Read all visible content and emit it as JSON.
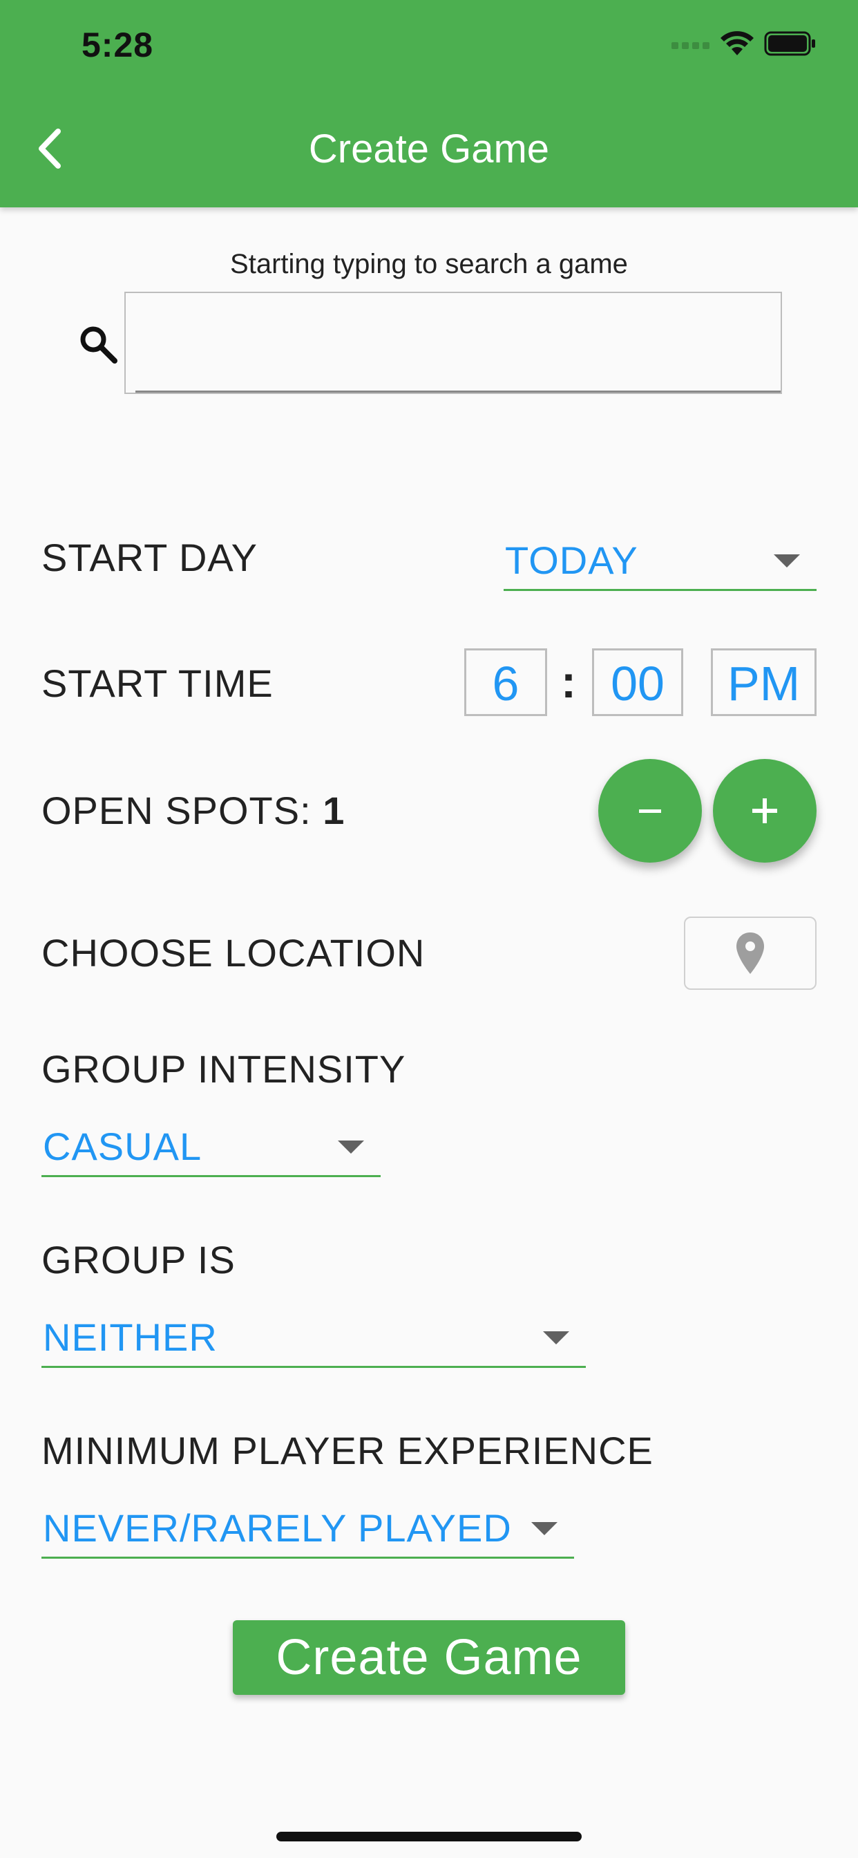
{
  "status_bar": {
    "time": "5:28"
  },
  "app_bar": {
    "title": "Create Game",
    "back_icon": "chevron-left-icon"
  },
  "search": {
    "hint": "Starting typing to search a game",
    "value": "",
    "icon": "search-icon"
  },
  "start_day": {
    "label": "START DAY",
    "value": "TODAY"
  },
  "start_time": {
    "label": "START TIME",
    "hour": "6",
    "separator": ":",
    "minute": "00",
    "period": "PM"
  },
  "open_spots": {
    "label": "OPEN SPOTS: ",
    "count": "1",
    "decrement": "−",
    "increment": "+"
  },
  "location": {
    "label": "CHOOSE LOCATION",
    "icon": "map-pin-icon"
  },
  "group_intensity": {
    "label": "GROUP INTENSITY",
    "value": "CASUAL"
  },
  "group_is": {
    "label": "GROUP IS",
    "value": "NEITHER"
  },
  "min_experience": {
    "label": "MINIMUM PLAYER EXPERIENCE",
    "value": "NEVER/RARELY PLAYED"
  },
  "submit": {
    "label": "Create Game"
  },
  "colors": {
    "primary": "#4caf50",
    "accent": "#2196f3",
    "text": "#222222"
  }
}
